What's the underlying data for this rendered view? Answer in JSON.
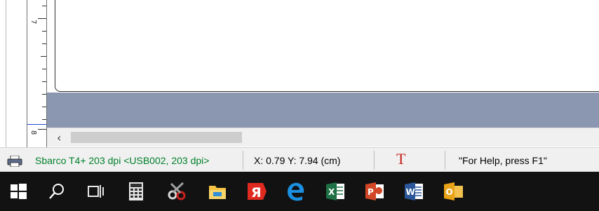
{
  "ruler": {
    "labels": [
      "7",
      "8"
    ]
  },
  "statusbar": {
    "printer_label": "Sbarco T4+ 203 dpi <USB002, 203 dpi>",
    "coordinates": "X: 0.79  Y: 7.94 (cm)",
    "text_tool_glyph": "T",
    "help_text": "\"For Help, press F1\""
  },
  "taskbar": {
    "items": [
      {
        "icon": "windows-start-icon"
      },
      {
        "icon": "search-icon"
      },
      {
        "icon": "task-view-icon"
      },
      {
        "icon": "calculator-icon"
      },
      {
        "icon": "snipping-tool-icon"
      },
      {
        "icon": "file-explorer-icon"
      },
      {
        "icon": "yandex-browser-icon"
      },
      {
        "icon": "edge-icon"
      },
      {
        "icon": "excel-icon"
      },
      {
        "icon": "powerpoint-icon"
      },
      {
        "icon": "word-icon"
      },
      {
        "icon": "outlook-icon"
      }
    ]
  },
  "colors": {
    "workspace": "#8b97b1",
    "printer_label": "#00802b",
    "text_tool": "#c8201c",
    "taskbar": "#121212"
  }
}
